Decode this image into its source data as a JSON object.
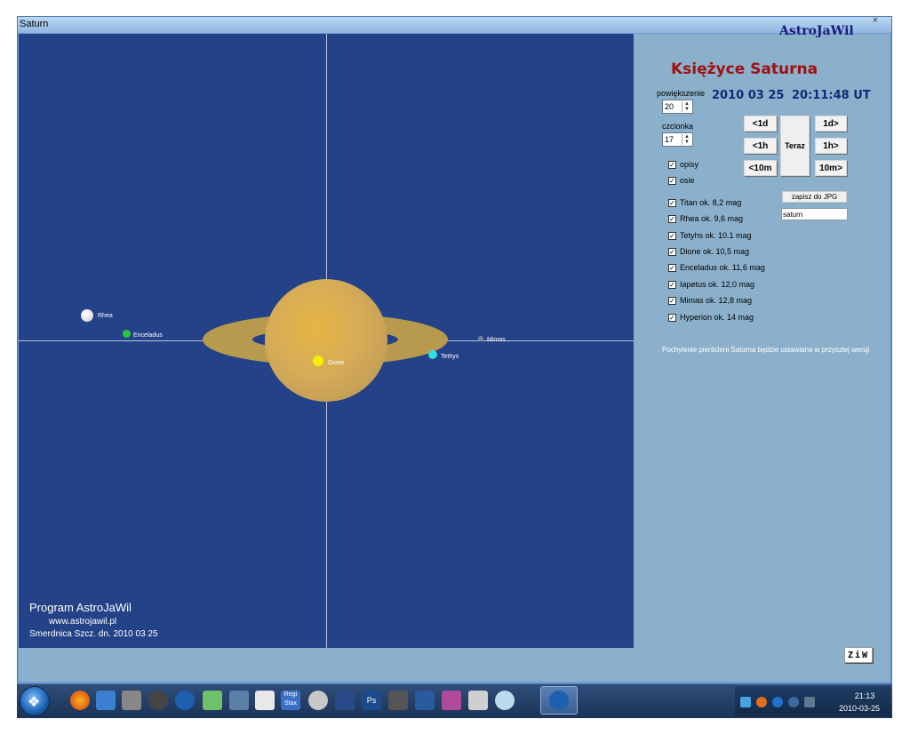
{
  "window": {
    "title": "Saturn",
    "close_glyph": "×"
  },
  "canvas": {
    "moons": [
      {
        "name": "Rhea",
        "color": "#e8e8e8"
      },
      {
        "name": "Enceladus",
        "color": "#2ec23a"
      },
      {
        "name": "Dione",
        "color": "#f5f000"
      },
      {
        "name": "Tethys",
        "color": "#2ee0e0"
      },
      {
        "name": "Mimas",
        "color": "#7a8296"
      }
    ],
    "program_title": "Program AstroJaWil",
    "program_url": "www.astrojawil.pl",
    "program_location": "Smerdnica Szcz. dn.  2010 03 25"
  },
  "panel": {
    "brand": "AstroJaWil",
    "heading": "Księżyce Saturna",
    "date": "2010 03 25",
    "time": "20:11:48 UT",
    "zoom_label": "powiększenie",
    "zoom_value": "20",
    "font_label": "czcionka",
    "font_value": "17",
    "buttons": {
      "back_day": "<1d",
      "fwd_day": "1d>",
      "back_hour": "<1h",
      "fwd_hour": "1h>",
      "back_10m": "<10m",
      "fwd_10m": "10m>",
      "now": "Teraz"
    },
    "options": [
      {
        "label": "opisy",
        "checked": true
      },
      {
        "label": "osie",
        "checked": true
      }
    ],
    "moon_toggles": [
      {
        "label": "Titan   ok. 8,2 mag",
        "checked": true
      },
      {
        "label": "Rhea   ok. 9,6 mag",
        "checked": true
      },
      {
        "label": "Tetyhs   ok. 10.1 mag",
        "checked": true
      },
      {
        "label": "Dione    ok. 10,5 mag",
        "checked": true
      },
      {
        "label": "Enceladus   ok. 11,6 mag",
        "checked": true
      },
      {
        "label": "Iapetus   ok. 12,0 mag",
        "checked": true
      },
      {
        "label": "Mimas   ok. 12,8 mag",
        "checked": true
      },
      {
        "label": "Hyperion   ok. 14 mag",
        "checked": true
      }
    ],
    "save_label": "zapisz do JPG",
    "file_value": "saturn",
    "note": "Pochylenie pierścieni Saturna będzie ustawiane w przyszłej wersji",
    "ziw_label": "ZiW"
  },
  "taskbar": {
    "clock_time": "21:13",
    "clock_date": "2010-03-25",
    "pinned_labels": {
      "regi": "Regi Stax",
      "ps": "Ps"
    }
  }
}
